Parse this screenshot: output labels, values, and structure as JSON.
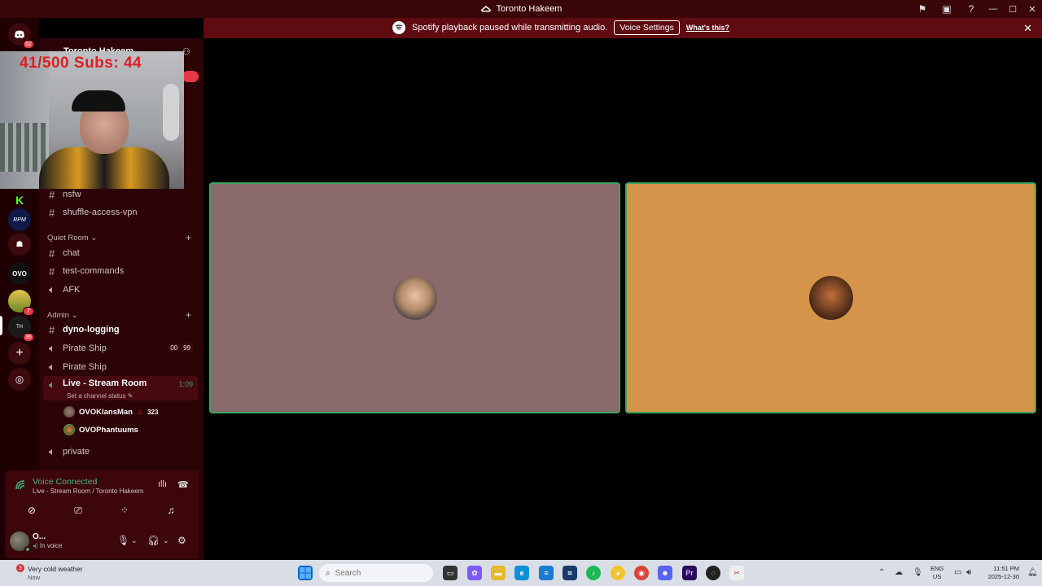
{
  "window": {
    "title": "Toronto Hakeem",
    "min_label": "—",
    "max_label": "☐",
    "close_label": "✕"
  },
  "notice": {
    "text": "Spotify playback paused while transmitting audio.",
    "button": "Voice Settings",
    "link": "What's this?",
    "close": "✕"
  },
  "rail": {
    "top_badge": "62",
    "server_badges": [
      "7",
      "36"
    ]
  },
  "server_header": {
    "name": "Toronto Hakeem"
  },
  "webcam": {
    "overlay_text": "41/500  Subs: 44"
  },
  "channels": {
    "top": [
      {
        "name": "nsfw"
      },
      {
        "name": "shuffle-access-vpn"
      }
    ],
    "quiet_room": {
      "label": "Quiet Room",
      "items": [
        "chat",
        "test-commands",
        "AFK"
      ]
    },
    "admin": {
      "label": "Admin",
      "items": [
        "dyno-logging",
        "Pirate Ship",
        "Pirate Ship",
        "Live - Stream Room",
        "private"
      ]
    },
    "pirate_pills": [
      "00",
      "99"
    ],
    "live_time": "1:09",
    "live_status": "Set a channel status",
    "voice_users": [
      {
        "name": "OVOKlansMan",
        "count": "323"
      },
      {
        "name": "OVOPhantuums"
      }
    ]
  },
  "voice_panel": {
    "title": "Voice Connected",
    "subtitle": "Live - Stream Room / Toronto Hakeem"
  },
  "user": {
    "name": "O...",
    "status": "In voice"
  },
  "taskbar": {
    "weather": "Very cold weather",
    "weather_sub": "Now",
    "weather_badge": "3",
    "search_placeholder": "Search",
    "lang_top": "ENG",
    "lang_bottom": "US",
    "time": "11:51 PM",
    "date": "2025-12-30"
  },
  "colors": {
    "accent_speaking": "#3ba55d",
    "tile1_bg": "#8a6a6a",
    "tile2_bg": "#d4944a",
    "notice_bg": "#5e0b11"
  }
}
